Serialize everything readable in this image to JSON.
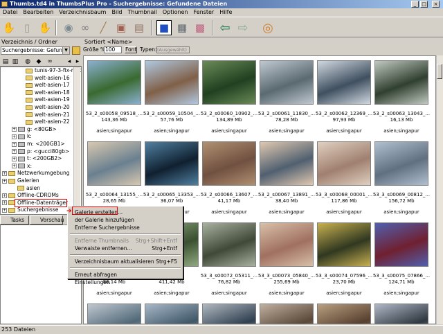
{
  "window": {
    "title": "Thumbs.td4 in ThumbsPlus Pro - Suchergebnisse: Gefundene Dateien"
  },
  "menubar": [
    "Datei",
    "Bearbeiten",
    "Verzeichnisbaum",
    "Bild",
    "Thumbnail",
    "Optionen",
    "Fenster",
    "Hilfe"
  ],
  "left": {
    "header": "Verzeichnis / Ordner",
    "search_combo": "Suchergebnisse: Gefundene D",
    "tree": [
      {
        "label": "tunis-97-3-fix-rest",
        "type": "folder"
      },
      {
        "label": "welt-asien-16",
        "type": "folder"
      },
      {
        "label": "welt-asien-17",
        "type": "folder"
      },
      {
        "label": "welt-asien-18",
        "type": "folder"
      },
      {
        "label": "welt-asien-19",
        "type": "folder"
      },
      {
        "label": "welt-asien-20",
        "type": "folder"
      },
      {
        "label": "welt-asien-21",
        "type": "folder"
      },
      {
        "label": "welt-asien-22",
        "type": "folder"
      },
      {
        "label": "g: <80GB>",
        "type": "drive"
      },
      {
        "label": "k:",
        "type": "drive"
      },
      {
        "label": "m: <200GB1>",
        "type": "drive"
      },
      {
        "label": "p: <gucci80gb>",
        "type": "drive"
      },
      {
        "label": "t: <200GB2>",
        "type": "drive"
      },
      {
        "label": "x:",
        "type": "drive"
      },
      {
        "label": "Netzwerkumgebung",
        "type": "net"
      },
      {
        "label": "Galerien",
        "type": "gal"
      },
      {
        "label": "asien",
        "type": "gal"
      },
      {
        "label": "Offline-CDROMs",
        "type": "cd"
      },
      {
        "label": "Offline-Datenträger",
        "type": "cd"
      },
      {
        "label": "Suchergebnisse",
        "type": "search"
      },
      {
        "label": "Gefundene Dateien",
        "type": "found"
      }
    ],
    "tabs": {
      "tasks": "Tasks",
      "preview": "Vorschau"
    }
  },
  "right": {
    "header": "Sortiert <Name>",
    "size_label": "Größe %",
    "size_value": "100",
    "font_btn": "Font",
    "types_label": "Typen:",
    "types_value": "(Ausgewählt)"
  },
  "thumbs": [
    {
      "name": "53_2_s00058_09518_...",
      "size": "143,36 Mb",
      "tag": "asien;singapur",
      "c1": "#3a6a30",
      "c2": "#8ab0d0"
    },
    {
      "name": "53_2_s00059_10504_...",
      "size": "57,76 Mb",
      "tag": "asien;singapur",
      "c1": "#806048",
      "c2": "#b0c8e0"
    },
    {
      "name": "53_2_s00060_10902_...",
      "size": "134,89 Mb",
      "tag": "asien;singapur",
      "c1": "#204020",
      "c2": "#6a8a58"
    },
    {
      "name": "53_2_s00061_11830_...",
      "size": "78,28 Mb",
      "tag": "asien;singapur",
      "c1": "#5a6a70",
      "c2": "#c0c8d0"
    },
    {
      "name": "53_2_s00062_12369_...",
      "size": "97,93 Mb",
      "tag": "asien;singapur",
      "c1": "#405060",
      "c2": "#d0d8e0"
    },
    {
      "name": "53_2_s00063_13043_...",
      "size": "16,13 Mb",
      "tag": "asien;singapur",
      "c1": "#304030",
      "c2": "#c0c8c0"
    },
    {
      "name": "53_2_s00064_13155_...",
      "size": "28,65 Mb",
      "tag": "asien;singapur",
      "c1": "#6a8090",
      "c2": "#d8c8b0"
    },
    {
      "name": "53_2_s00065_13353_...",
      "size": "36,07 Mb",
      "tag": "asien;singapur",
      "c1": "#102030",
      "c2": "#5080a0"
    },
    {
      "name": "53_2_s00066_13607_...",
      "size": "41,17 Mb",
      "tag": "asien;singapur",
      "c1": "#705040",
      "c2": "#b09070"
    },
    {
      "name": "53_2_s00067_13891_...",
      "size": "38,40 Mb",
      "tag": "asien;singapur",
      "c1": "#506070",
      "c2": "#e0c8b0"
    },
    {
      "name": "53_3_s00068_00001_...",
      "size": "117,86 Mb",
      "tag": "asien;singapur",
      "c1": "#a08070",
      "c2": "#e0d0c0"
    },
    {
      "name": "53_3_s00069_00812_...",
      "size": "156,72 Mb",
      "tag": "asien;singapur",
      "c1": "#607080",
      "c2": "#b0c0d0"
    },
    {
      "name": "",
      "size": "86,14 Mb",
      "tag": "asien;singapur",
      "c1": "#486040",
      "c2": "#a0b890"
    },
    {
      "name": "",
      "size": "411,42 Mb",
      "tag": "asien;singapur",
      "c1": "#3a5030",
      "c2": "#90a880"
    },
    {
      "name": "53_3_s00072_05311_...",
      "size": "76,82 Mb",
      "tag": "asien;singapur",
      "c1": "#404838",
      "c2": "#a8b0a0"
    },
    {
      "name": "53_3_s00073_05840_...",
      "size": "255,69 Mb",
      "tag": "asien;singapur",
      "c1": "#a07060",
      "c2": "#d8c0a8"
    },
    {
      "name": "53_3_s00074_07596_...",
      "size": "23,70 Mb",
      "tag": "asien;singapur",
      "c1": "#303820",
      "c2": "#c8b050"
    },
    {
      "name": "53_3_s00075_07866_...",
      "size": "124,71 Mb",
      "tag": "asien;singapur",
      "c1": "#702030",
      "c2": "#5060b0"
    },
    {
      "name": "",
      "size": "",
      "tag": "",
      "c1": "#506878",
      "c2": "#c0c8d0"
    },
    {
      "name": "",
      "size": "",
      "tag": "",
      "c1": "#405868",
      "c2": "#a8b8c8"
    },
    {
      "name": "",
      "size": "",
      "tag": "",
      "c1": "#304050",
      "c2": "#b0b8c0"
    },
    {
      "name": "",
      "size": "",
      "tag": "",
      "c1": "#5a4838",
      "c2": "#c0b0a0"
    },
    {
      "name": "",
      "size": "",
      "tag": "",
      "c1": "#584030",
      "c2": "#b8a080"
    },
    {
      "name": "",
      "size": "",
      "tag": "",
      "c1": "#303840",
      "c2": "#b0b8c8"
    }
  ],
  "context_menu": [
    {
      "label": "Galerie erstellen...",
      "shortcut": "",
      "disabled": false
    },
    {
      "label": "der Galerie hinzufügen",
      "shortcut": "",
      "disabled": false
    },
    {
      "label": "Entferne Suchergebnisse",
      "shortcut": "",
      "disabled": false
    },
    {
      "sep": true
    },
    {
      "label": "Entferne Thumbnails",
      "shortcut": "Strg+Shift+Entf",
      "disabled": true
    },
    {
      "label": "Verwaiste entfernen...",
      "shortcut": "Strg+Entf",
      "disabled": false
    },
    {
      "sep": true
    },
    {
      "label": "Verzeichnisbaum aktualisieren",
      "shortcut": "Strg+F5",
      "disabled": false
    },
    {
      "sep": true
    },
    {
      "label": "Erneut abfragen",
      "shortcut": "",
      "disabled": false
    },
    {
      "label": "Einstellungen",
      "shortcut": "",
      "disabled": false
    }
  ],
  "status": "253 Dateien"
}
